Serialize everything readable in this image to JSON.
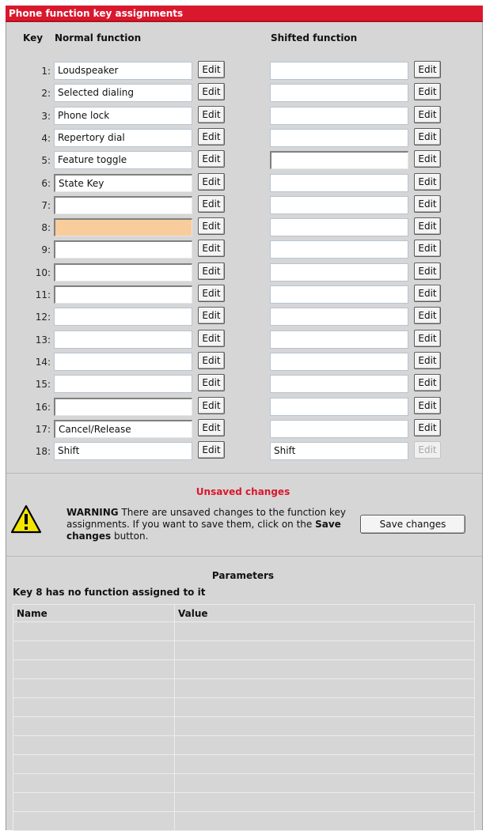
{
  "title": "Phone function key assignments",
  "headers": {
    "key": "Key",
    "normal": "Normal function",
    "shifted": "Shifted function"
  },
  "edit_label": "Edit",
  "keys": [
    {
      "num": "1:",
      "normal": "Loudspeaker",
      "shifted": ""
    },
    {
      "num": "2:",
      "normal": "Selected dialing",
      "shifted": ""
    },
    {
      "num": "3:",
      "normal": "Phone lock",
      "shifted": ""
    },
    {
      "num": "4:",
      "normal": "Repertory dial",
      "shifted": ""
    },
    {
      "num": "5:",
      "normal": "Feature toggle",
      "shifted": ""
    },
    {
      "num": "6:",
      "normal": "State Key",
      "shifted": ""
    },
    {
      "num": "7:",
      "normal": "",
      "shifted": ""
    },
    {
      "num": "8:",
      "normal": "",
      "shifted": ""
    },
    {
      "num": "9:",
      "normal": "",
      "shifted": ""
    },
    {
      "num": "10:",
      "normal": "",
      "shifted": ""
    },
    {
      "num": "11:",
      "normal": "",
      "shifted": ""
    },
    {
      "num": "12:",
      "normal": "",
      "shifted": ""
    },
    {
      "num": "13:",
      "normal": "",
      "shifted": ""
    },
    {
      "num": "14:",
      "normal": "",
      "shifted": ""
    },
    {
      "num": "15:",
      "normal": "",
      "shifted": ""
    },
    {
      "num": "16:",
      "normal": "",
      "shifted": ""
    },
    {
      "num": "17:",
      "normal": "Cancel/Release",
      "shifted": ""
    },
    {
      "num": "18:",
      "normal": "Shift",
      "shifted": "Shift"
    }
  ],
  "unsaved": {
    "title": "Unsaved changes",
    "warning_bold": "WARNING",
    "warning_text": " There are unsaved changes to the function key assignments. If you want to save them, click on the ",
    "warning_bold2": "Save changes",
    "warning_tail": " button.",
    "save_button": "Save changes"
  },
  "parameters": {
    "title": "Parameters",
    "message": "Key 8 has no function assigned to it",
    "col_name": "Name",
    "col_value": "Value"
  },
  "colors": {
    "title_bar": "#d9182d",
    "warning_title": "#d9182d",
    "highlight": "#f9cc9b"
  }
}
